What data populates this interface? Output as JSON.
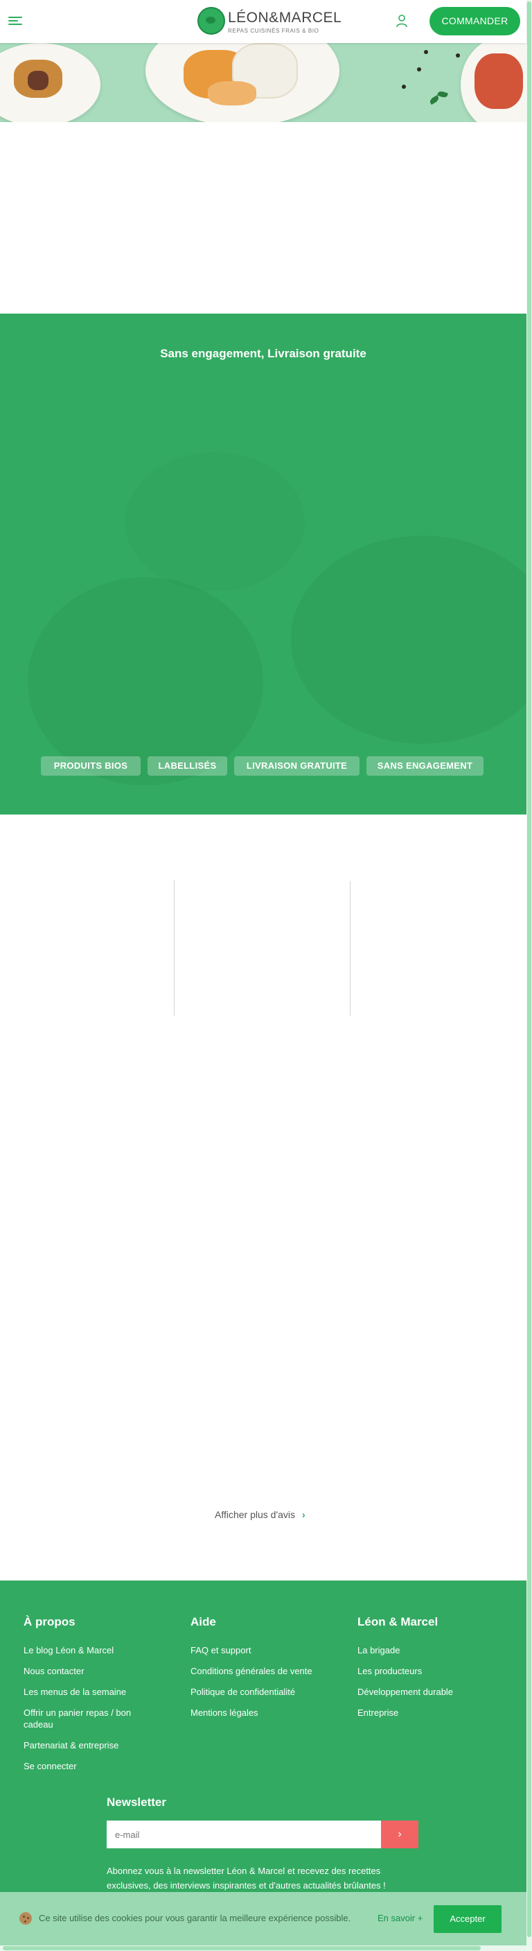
{
  "header": {
    "brand_name": "LÉON&MARCEL",
    "brand_tagline": "REPAS CUISINÉS FRAIS & BIO",
    "order_button": "COMMANDER",
    "menu_icon": "menu-icon",
    "account_icon": "user-icon"
  },
  "band": {
    "title": "Sans engagement, Livraison gratuite",
    "pills": [
      "PRODUITS BIOS",
      "LABELLISÉS",
      "LIVRAISON GRATUITE",
      "SANS ENGAGEMENT"
    ]
  },
  "reviews": {
    "more_label": "Afficher plus d'avis",
    "more_icon": "chevron-right-icon"
  },
  "footer": {
    "about": {
      "title": "À propos",
      "links": [
        "Le blog Léon & Marcel",
        "Nous contacter",
        "Les menus de la semaine",
        "Offrir un panier repas / bon cadeau",
        "Partenariat & entreprise",
        "Se connecter"
      ]
    },
    "help": {
      "title": "Aide",
      "links": [
        "FAQ et support",
        "Conditions générales de vente",
        "Politique de confidentialité",
        "Mentions légales"
      ]
    },
    "company": {
      "title": "Léon & Marcel",
      "links": [
        "La brigade",
        "Les producteurs",
        "Développement durable",
        "Entreprise"
      ]
    },
    "newsletter": {
      "title": "Newsletter",
      "placeholder": "e-mail",
      "submit_icon": "chevron-right-icon",
      "text": "Abonnez vous à la newsletter Léon & Marcel et recevez des recettes exclusives, des interviews inspirantes et d'autres actualités brûlantes !"
    }
  },
  "cookie": {
    "text": "Ce site utilise des cookies pour vous garantir la meilleure expérience possible.",
    "more": "En savoir +",
    "accept": "Accepter"
  },
  "colors": {
    "brand_green": "#1fb051",
    "band_green": "#33aa62",
    "newsletter_button": "#f26464",
    "cookie_bar": "#9ad9b2"
  }
}
